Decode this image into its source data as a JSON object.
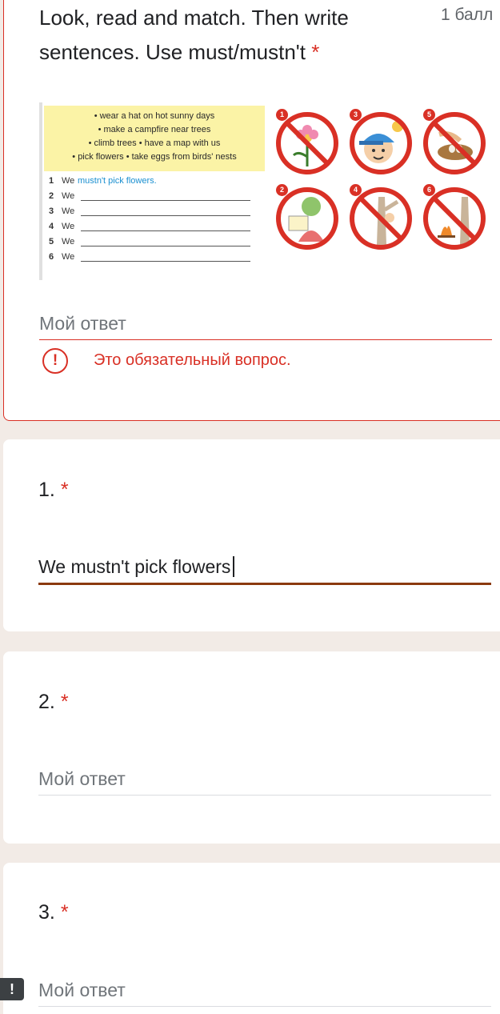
{
  "question": {
    "title": "Look, read and match. Then write sentences. Use must/mustn't",
    "required_mark": "*",
    "points": "1 балл",
    "image": {
      "phrases": [
        "• wear a hat on hot sunny days",
        "• make a campfire near trees",
        "• climb trees  • have a map with us",
        "• pick flowers  • take eggs from birds' nests"
      ],
      "lines": [
        {
          "num": "1",
          "we": "We",
          "answer": "mustn't pick flowers."
        },
        {
          "num": "2",
          "we": "We",
          "answer": ""
        },
        {
          "num": "3",
          "we": "We",
          "answer": ""
        },
        {
          "num": "4",
          "we": "We",
          "answer": ""
        },
        {
          "num": "5",
          "we": "We",
          "answer": ""
        },
        {
          "num": "6",
          "we": "We",
          "answer": ""
        }
      ],
      "sign_numbers": [
        "1",
        "3",
        "5",
        "2",
        "4",
        "6"
      ]
    },
    "answer_placeholder": "Мой ответ",
    "error_text": "Это обязательный вопрос.",
    "error_icon": "!"
  },
  "q1": {
    "label": "1.",
    "required_mark": "*",
    "value": "We mustn't pick flowers"
  },
  "q2": {
    "label": "2.",
    "required_mark": "*",
    "placeholder": "Мой ответ"
  },
  "q3": {
    "label": "3.",
    "required_mark": "*",
    "placeholder": "Мой ответ"
  },
  "side_alert": "!",
  "colors": {
    "error": "#d93025",
    "accent_underline": "#8b3a0f",
    "background": "#f2ebe6"
  }
}
